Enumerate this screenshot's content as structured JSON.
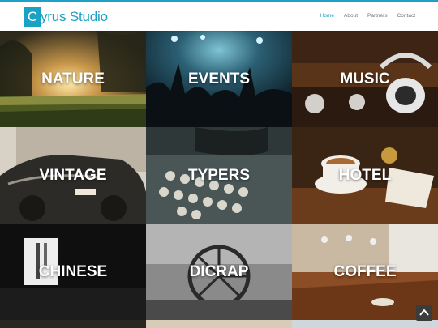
{
  "brand": {
    "logo_mark": "C",
    "logo_rest": "yrus Studio"
  },
  "nav": {
    "items": [
      "Home",
      "About",
      "Partners",
      "Contact"
    ],
    "active": "Home"
  },
  "tiles": [
    "NATURE",
    "EVENTS",
    "MUSIC",
    "VINTAGE",
    "TYPERS",
    "HOTEL",
    "CHINESE",
    "DICRAP",
    "COFFEE"
  ],
  "colors": {
    "accent": "#1da1c7"
  },
  "icons": {
    "back_to_top": "chevron-up-icon"
  }
}
